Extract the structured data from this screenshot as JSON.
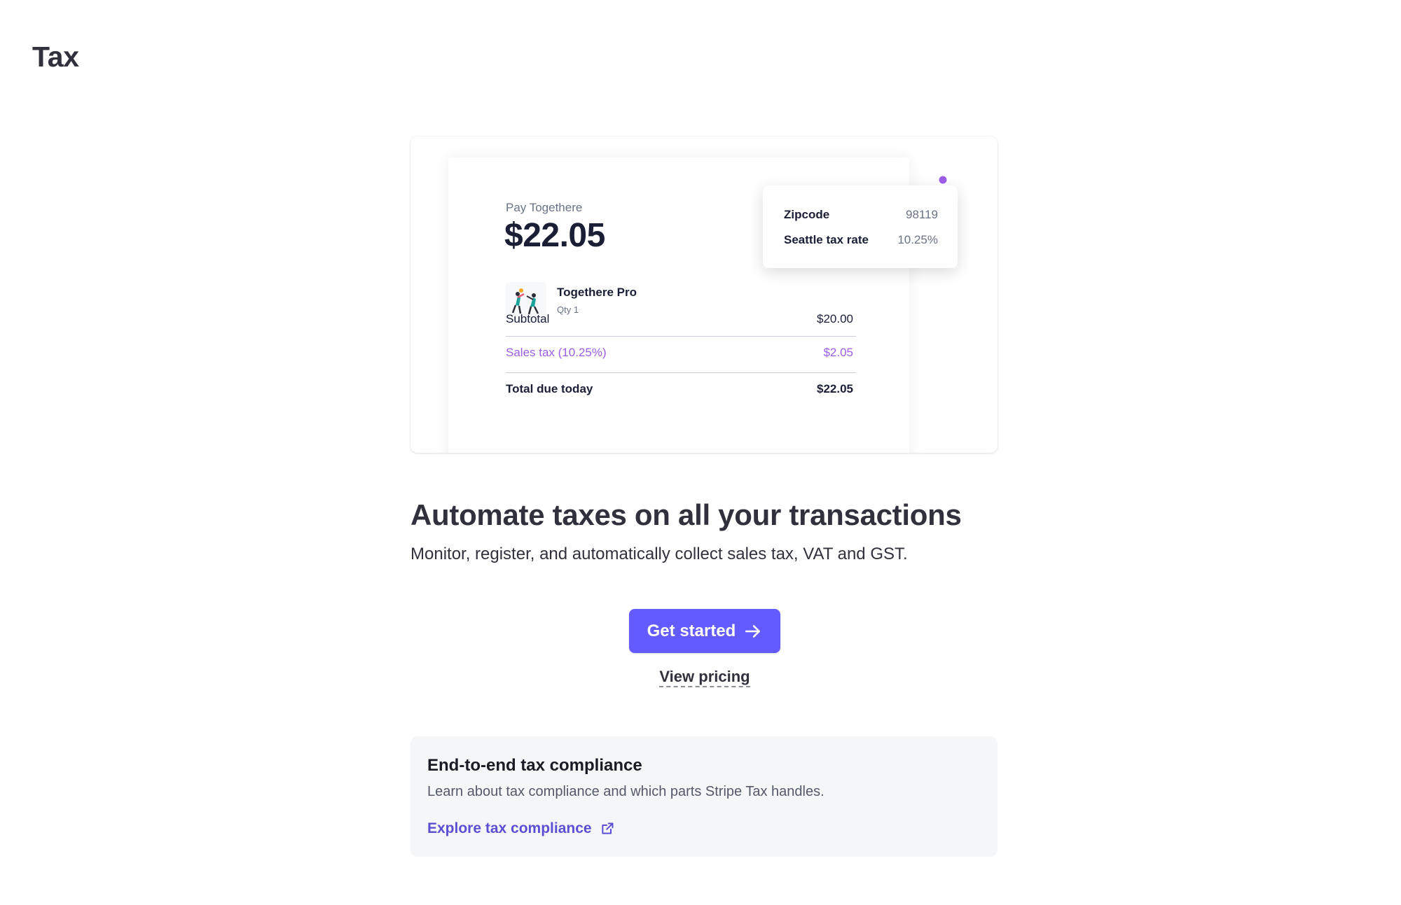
{
  "page": {
    "title": "Tax"
  },
  "illustration": {
    "pay_label": "Pay Togethere",
    "amount": "$22.05",
    "product": {
      "name": "Togethere Pro",
      "qty": "Qty 1"
    },
    "lines": [
      {
        "label": "Subtotal",
        "value": "$20.00"
      },
      {
        "label": "Sales tax (10.25%)",
        "value": "$2.05"
      },
      {
        "label": "Total due today",
        "value": "$22.05"
      }
    ],
    "popup": {
      "rows": [
        {
          "label": "Zipcode",
          "value": "98119"
        },
        {
          "label": "Seattle tax rate",
          "value": "10.25%"
        }
      ]
    },
    "accent_color": "#9b5de5"
  },
  "hero": {
    "headline": "Automate taxes on all your transactions",
    "subheadline": "Monitor, register, and automatically collect sales tax, VAT and GST."
  },
  "actions": {
    "get_started_label": "Get started",
    "get_started_icon": "arrow-right-icon",
    "view_pricing_label": "View pricing",
    "primary_color": "#635bff"
  },
  "info_card": {
    "title": "End-to-end tax compliance",
    "description": "Learn about tax compliance and which parts Stripe Tax handles.",
    "link_label": "Explore tax compliance",
    "link_icon": "external-link-icon",
    "link_color": "#5b4fd6"
  }
}
